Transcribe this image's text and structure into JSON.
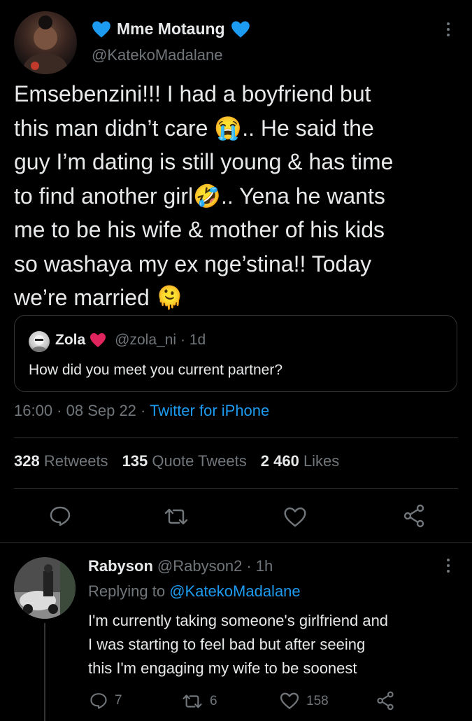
{
  "tweet": {
    "author_name": "Mme Motaung",
    "author_handle": "@KatekoMadalane",
    "text": "Emsebenzini!!! I had a boyfriend but\nthis man didn’t care 😭.. He said the\nguy I’m dating is still young & has time\nto find another girl🤣.. Yena he wants\nme to be his wife & mother of his kids\nso washaya my ex nge’stina!! Today\nwe’re married 🫠",
    "quote": {
      "name": "Zola",
      "handle": "@zola_ni",
      "time": "· 1d",
      "text": "How did you meet you current partner?"
    },
    "time": "16:00 · 08 Sep 22 ·",
    "client": "Twitter for iPhone",
    "stats": {
      "retweets_count": "328",
      "retweets_label": "Retweets",
      "quotes_count": "135",
      "quotes_label": "Quote Tweets",
      "likes_count": "2 460",
      "likes_label": "Likes"
    }
  },
  "reply": {
    "name": "Rabyson",
    "handle": "@Rabyson2",
    "time": "· 1h",
    "replying_prefix": "Replying to",
    "replying_to": "@KatekoMadalane",
    "text": "I'm currently taking someone's girlfriend and\nI was starting to feel bad but after seeing\nthis  I'm engaging my wife to be soonest",
    "reply_count": "7",
    "retweet_count": "6",
    "like_count": "158"
  },
  "icons": {
    "verified_heart": "blue-heart-icon",
    "quote_heart": "red-heart-icon",
    "more": "more-vertical-icon",
    "reply": "reply-icon",
    "retweet": "retweet-icon",
    "like": "like-icon",
    "share": "share-icon"
  },
  "colors": {
    "background": "#000000",
    "text": "#e7e9ea",
    "muted": "#71767b",
    "link": "#1d9bf0",
    "heart_blue": "#1d9bf0",
    "heart_red": "#e0245e",
    "divider": "#2f3336"
  }
}
